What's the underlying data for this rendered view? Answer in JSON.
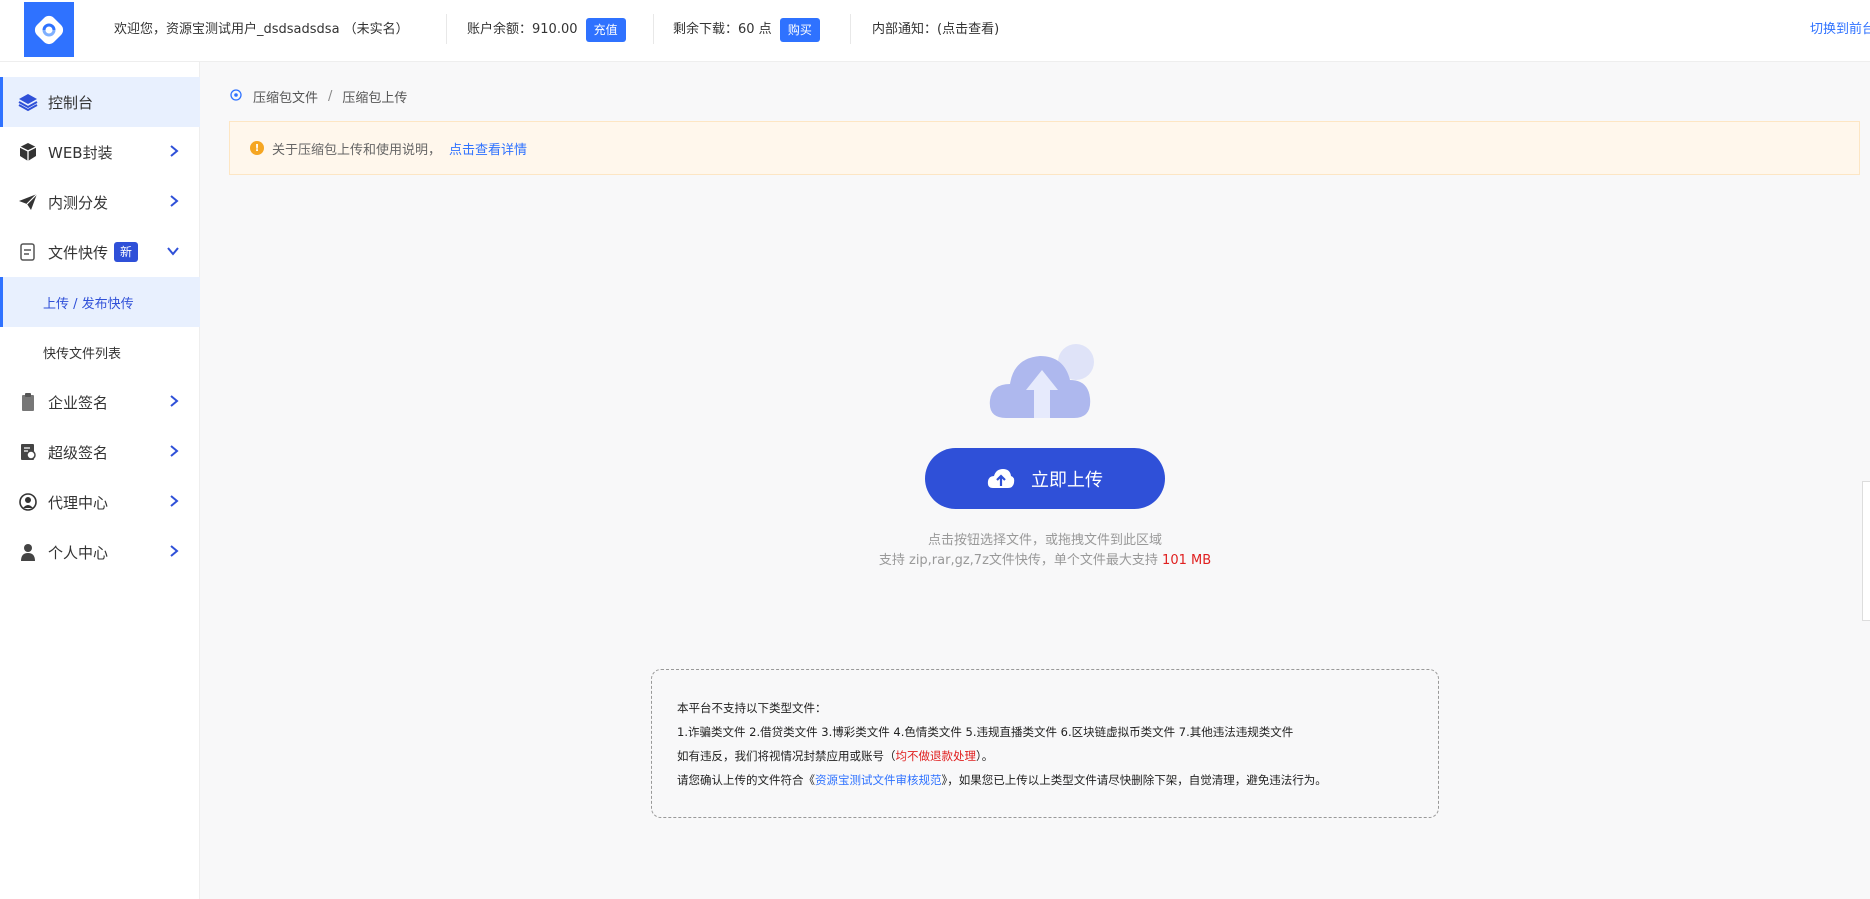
{
  "header": {
    "welcome": "欢迎您，资源宝测试用户_dsdsadsdsa （未实名）",
    "balance_label": "账户余额：910.00",
    "recharge_button": "充值",
    "downloads_label": "剩余下载：60 点",
    "buy_button": "购买",
    "notice_label": "内部通知：(点击查看)",
    "switch_link": "切换到前台"
  },
  "sidebar": {
    "items": [
      {
        "label": "控制台",
        "icon": "layers-icon"
      },
      {
        "label": "WEB封装",
        "icon": "box-icon"
      },
      {
        "label": "内测分发",
        "icon": "paper-plane-icon"
      },
      {
        "label": "文件快传",
        "icon": "file-transfer-icon",
        "badge": "新"
      },
      {
        "label": "企业签名",
        "icon": "clipboard-icon"
      },
      {
        "label": "超级签名",
        "icon": "certificate-icon"
      },
      {
        "label": "代理中心",
        "icon": "agent-icon"
      },
      {
        "label": "个人中心",
        "icon": "user-icon"
      }
    ],
    "sub_items": [
      {
        "label": "上传 / 发布快传"
      },
      {
        "label": "快传文件列表"
      }
    ]
  },
  "breadcrumb": {
    "first": "压缩包文件",
    "separator": "/",
    "second": "压缩包上传"
  },
  "notice": {
    "text": "关于压缩包上传和使用说明，",
    "link": "点击查看详情"
  },
  "upload": {
    "button_label": "立即上传",
    "hint_line1": "点击按钮选择文件，或拖拽文件到此区域",
    "hint_line2": "支持 zip,rar,gz,7z文件快传，单个文件最大支持",
    "max_size": "101 MB"
  },
  "rules": {
    "line1": "本平台不支持以下类型文件：",
    "line2": "1.诈骗类文件 2.借贷类文件 3.博彩类文件 4.色情类文件 5.违规直播类文件 6.区块链虚拟币类文件 7.其他违法违规类文件",
    "line3_prefix": "如有违反，我们将视情况封禁应用或账号（",
    "line3_red": "均不做退款处理",
    "line3_suffix": "）。",
    "line4_prefix": "请您确认上传的文件符合《",
    "line4_link": "资源宝测试文件审核规范",
    "line4_suffix": "》，如果您已上传以上类型文件请尽快删除下架，自觉清理，避免违法行为。"
  },
  "colors": {
    "primary": "#2f50d8",
    "accent": "#2f72ff",
    "warning": "#f5a623",
    "danger": "#e02020"
  }
}
